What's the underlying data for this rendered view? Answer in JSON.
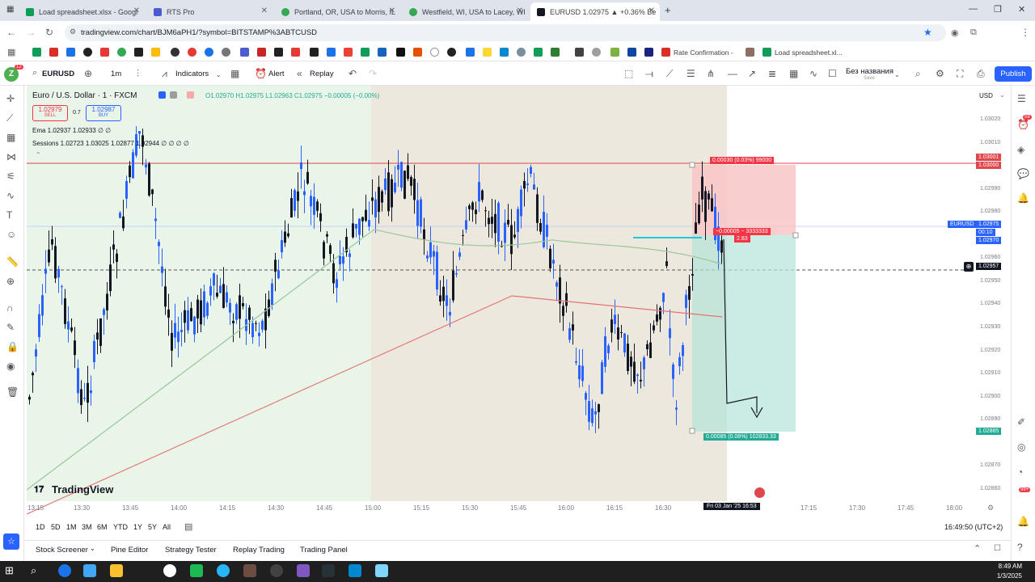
{
  "browser": {
    "tabs": [
      {
        "title": "Load spreadsheet.xlsx - Googl",
        "color": "#0f9d58",
        "active": false
      },
      {
        "title": "RTS Pro",
        "color": "#4d5bd1",
        "active": false
      },
      {
        "title": "Portland, OR, USA to Morris, IL",
        "color": "#34a853",
        "active": false
      },
      {
        "title": "Westfield, WI, USA to Lacey, WI",
        "color": "#34a853",
        "active": false
      },
      {
        "title": "EURUSD 1.02975 ▲ +0.36% Be",
        "color": "#131722",
        "active": true
      }
    ],
    "url": "tradingview.com/chart/BJM6aPH1/?symbol=BITSTAMP%3ABTCUSD",
    "bookmarks": [
      {
        "label": "Rate Confirmation -",
        "color": "#d93025"
      },
      {
        "label": "Load spreadsheet.xl...",
        "color": "#0f9d58"
      }
    ]
  },
  "toolbar": {
    "symbol": "EURUSD",
    "interval": "1m",
    "indicators_label": "Indicators",
    "alert_label": "Alert",
    "replay_label": "Replay",
    "layout_name": "Без названия",
    "layout_sub": "Save",
    "publish_label": "Publish",
    "avatar_letter": "Z",
    "avatar_badge": "12"
  },
  "chart": {
    "instrument": "Euro / U.S. Dollar · 1 · FXCM",
    "ohlc": "O1.02970  H1.02975  L1.02963  C1.02975  −0.00005 (−0.00%)",
    "sell_price": "1.02979",
    "sell_label": "SELL",
    "spread": "0.7",
    "buy_price": "1.02987",
    "buy_label": "BUY",
    "ema_label": "Ema  1.02937  1.02933  ∅  ∅",
    "sessions_label": "Sessions  1.02723  1.03025  1.02877  1.02944  ∅  ∅  ∅  ∅",
    "currency": "USD",
    "watermark": "TradingView",
    "stop_label": "0.00030 (0.03%) 99000",
    "target_label": "0.00085 (0.08%) 102833.33",
    "entry_label_1": "−0.00005 − 3333333",
    "entry_label_2": "2.83",
    "price_tags": {
      "stop_a": "1.03001",
      "stop_b": "1.03000",
      "symbol_tag": "EURUSD",
      "last_price": "1.02975",
      "countdown": "00:10",
      "last_b": "1.02970",
      "crosshair": "1.02957",
      "target": "1.02885"
    },
    "price_axis": [
      "1.03020",
      "1.03010",
      "1.02990",
      "1.02980",
      "1.02960",
      "1.02950",
      "1.02940",
      "1.02930",
      "1.02920",
      "1.02910",
      "1.02900",
      "1.02890",
      "1.02870",
      "1.02860"
    ],
    "time_axis": [
      "13:15",
      "13:30",
      "13:45",
      "14:00",
      "14:15",
      "14:30",
      "14:45",
      "15:00",
      "15:15",
      "15:30",
      "15:45",
      "16:00",
      "16:15",
      "16:30",
      "17:15",
      "17:30",
      "17:45",
      "18:00"
    ],
    "crosshair_time": "Fri 03 Jan '25   16:53",
    "clock": "16:49:50 (UTC+2)",
    "colors": {
      "up": "#2962ff",
      "down": "#131722",
      "ema_fast": "#9cc79c",
      "ema_slow": "#e57373",
      "session_a": "#e9f5e9",
      "session_b": "#ede8dd",
      "stop_zone": "#f7c6c5",
      "target_zone": "#b4e4d9",
      "resistance": "#e0474c"
    }
  },
  "range_buttons": [
    "1D",
    "5D",
    "1M",
    "3M",
    "6M",
    "YTD",
    "1Y",
    "5Y",
    "All"
  ],
  "bottom_tabs": [
    "Stock Screener",
    "Pine Editor",
    "Strategy Tester",
    "Replay Trading",
    "Trading Panel"
  ],
  "right_badges": {
    "alerts": "59",
    "notifications": "99+"
  },
  "taskbar": {
    "time": "8:49 AM",
    "date": "1/3/2025"
  }
}
